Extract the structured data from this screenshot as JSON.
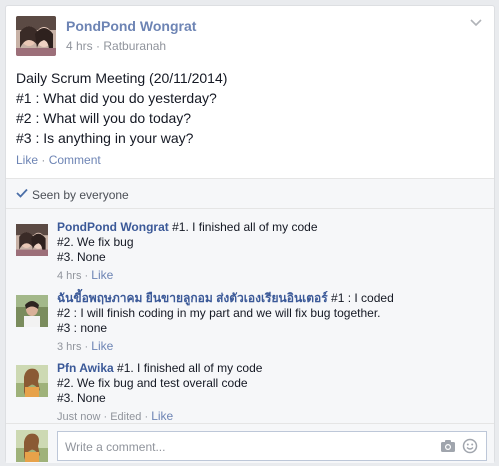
{
  "post": {
    "author": "PondPond Wongrat",
    "time": "4 hrs",
    "location": "Ratburanah",
    "body_lines": [
      "Daily Scrum Meeting (20/11/2014)",
      "#1 : What did you do yesterday?",
      "#2 : What will you do today?",
      "#3 : Is anything in your way?"
    ],
    "actions": {
      "like": "Like",
      "comment": "Comment",
      "separator": "·"
    }
  },
  "seen": {
    "text": "Seen by everyone"
  },
  "comments": [
    {
      "author": "PondPond Wongrat",
      "first_line": " #1. I finished all of my code",
      "lines": [
        "#2. We fix bug",
        "#3. None"
      ],
      "time": "4 hrs",
      "like": "Like"
    },
    {
      "author": "ฉันขี้อพฤษภาคม ยืนขายลูกอม ส่งตัวเองเรียนอินเตอร์",
      "first_line": " #1 : I coded",
      "lines": [
        "#2 : I will finish coding in my part and we will fix bug together.",
        "#3 : none"
      ],
      "time": "3 hrs",
      "like": "Like"
    },
    {
      "author": "Pfn Awika",
      "first_line": " #1. I finished all of my code",
      "lines": [
        "#2. We fix bug and test overall code",
        "#3. None"
      ],
      "time": "Just now",
      "edited": "Edited",
      "like": "Like"
    }
  ],
  "reply": {
    "placeholder": "Write a comment..."
  },
  "icons": {
    "chevron": "chevron-down-icon",
    "check": "checkmark-icon",
    "camera": "camera-icon",
    "emoji": "smile-icon"
  },
  "colors": {
    "link": "#3b5998",
    "muted": "#90949c",
    "action": "#6d84b4"
  }
}
